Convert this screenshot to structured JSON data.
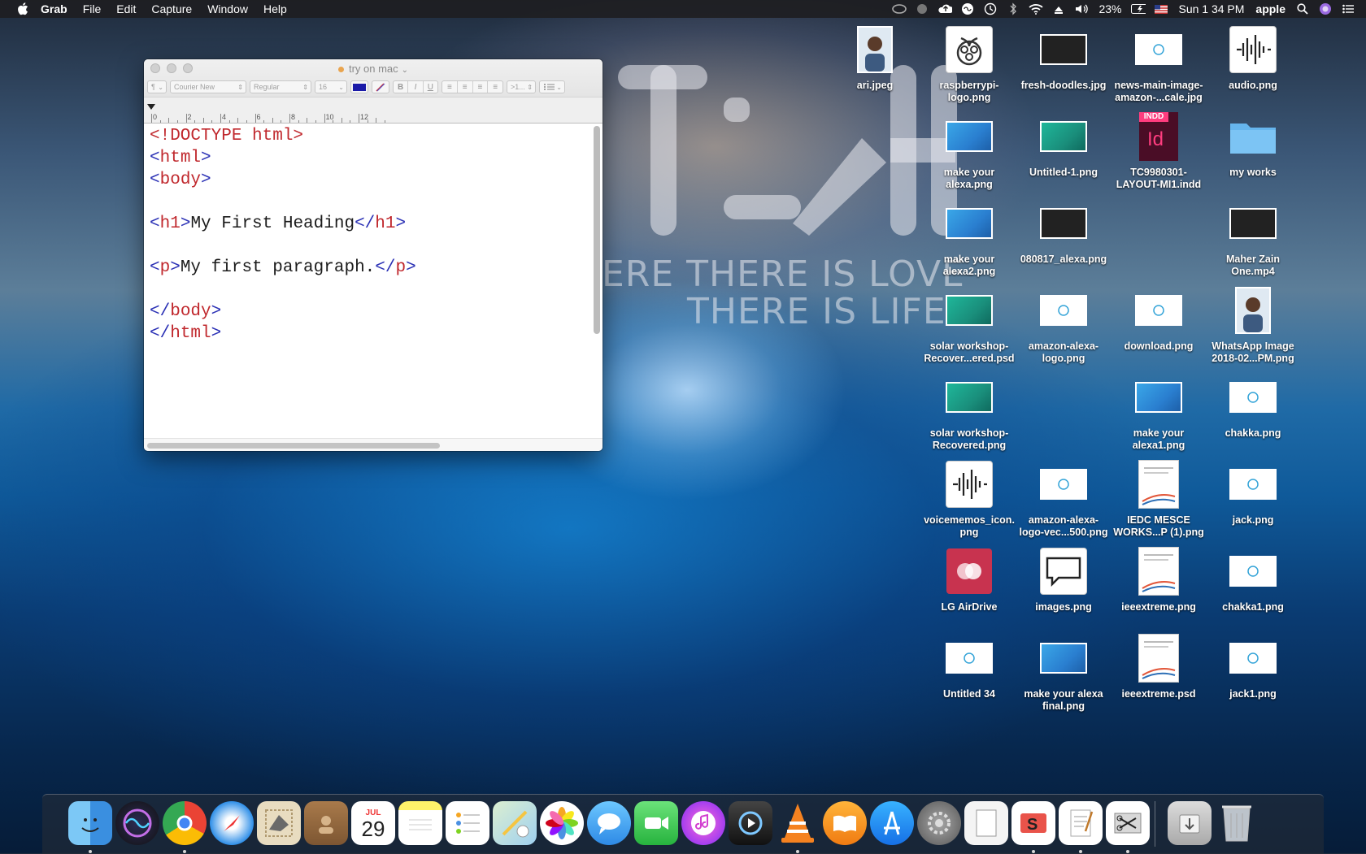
{
  "menubar": {
    "app": "Grab",
    "items": [
      "File",
      "Edit",
      "Capture",
      "Window",
      "Help"
    ],
    "battery": "23%",
    "clock": "Sun 1 34 PM",
    "user": "apple"
  },
  "wallpaper": {
    "line1": "ERE THERE IS LOVE",
    "line2": "THERE IS LIFE"
  },
  "textedit": {
    "title": "try on mac",
    "font_family": "Courier New",
    "font_style": "Regular",
    "font_size": "16",
    "paragraph_btn": "¶",
    "spacing": ">1...",
    "ruler_numbers": [
      "0",
      "2",
      "4",
      "6",
      "8",
      "10",
      "12"
    ],
    "lines": [
      {
        "parts": [
          [
            "tag",
            "<!DOCTYPE html>"
          ]
        ]
      },
      {
        "parts": [
          [
            "br",
            "<"
          ],
          [
            "tag",
            "html"
          ],
          [
            "br",
            ">"
          ]
        ]
      },
      {
        "parts": [
          [
            "br",
            "<"
          ],
          [
            "tag",
            "body"
          ],
          [
            "br",
            ">"
          ]
        ]
      },
      {
        "parts": []
      },
      {
        "parts": [
          [
            "br",
            "<"
          ],
          [
            "tag",
            "h1"
          ],
          [
            "br",
            ">"
          ],
          [
            "txt",
            "My First Heading"
          ],
          [
            "br",
            "</"
          ],
          [
            "tag",
            "h1"
          ],
          [
            "br",
            ">"
          ]
        ]
      },
      {
        "parts": []
      },
      {
        "parts": [
          [
            "br",
            "<"
          ],
          [
            "tag",
            "p"
          ],
          [
            "br",
            ">"
          ],
          [
            "txt",
            "My first paragraph."
          ],
          [
            "br",
            "</"
          ],
          [
            "tag",
            "p"
          ],
          [
            "br",
            ">"
          ]
        ]
      },
      {
        "parts": []
      },
      {
        "parts": [
          [
            "br",
            "</"
          ],
          [
            "tag",
            "body"
          ],
          [
            "br",
            ">"
          ]
        ]
      },
      {
        "parts": [
          [
            "br",
            "</"
          ],
          [
            "tag",
            "html"
          ],
          [
            "br",
            ">"
          ]
        ]
      }
    ]
  },
  "desktop": {
    "icons": [
      {
        "label": "ari.jpeg",
        "kind": "photo"
      },
      {
        "label": "raspberrypi-\nlogo.png",
        "kind": "raspberry"
      },
      {
        "label": "fresh-doodles.jpg",
        "kind": "dark"
      },
      {
        "label": "news-main-image-\namazon-...cale.jpg",
        "kind": "white"
      },
      {
        "label": "audio.png",
        "kind": "audio"
      },
      {
        "label": "make your\nalexa.png",
        "kind": "blue"
      },
      {
        "label": "Untitled-1.png",
        "kind": "teal"
      },
      {
        "label": "TC9980301-\nLAYOUT-MI1.indd",
        "kind": "indd"
      },
      {
        "label": "my works",
        "kind": "folder"
      },
      {
        "label": "make your\nalexa2.png",
        "kind": "blue"
      },
      {
        "label": "080817_alexa.png",
        "kind": "dark"
      },
      {
        "label": "Maher Zain\nOne.mp4",
        "kind": "dark"
      },
      {
        "label": "solar workshop-\nRecover...ered.psd",
        "kind": "teal"
      },
      {
        "label": "amazon-alexa-\nlogo.png",
        "kind": "white"
      },
      {
        "label": "download.png",
        "kind": "white"
      },
      {
        "label": "WhatsApp Image\n2018-02...PM.png",
        "kind": "photo"
      },
      {
        "label": "solar workshop-\nRecovered.png",
        "kind": "teal"
      },
      {
        "label": "make your\nalexa1.png",
        "kind": "blue"
      },
      {
        "label": "chakka.png",
        "kind": "white"
      },
      {
        "label": "voicememos_icon.\npng",
        "kind": "audio"
      },
      {
        "label": "amazon-alexa-\nlogo-vec...500.png",
        "kind": "white"
      },
      {
        "label": "IEDC MESCE\nWORKS...P (1).png",
        "kind": "doc"
      },
      {
        "label": "jack.png",
        "kind": "white"
      },
      {
        "label": "LG AirDrive",
        "kind": "lg"
      },
      {
        "label": "images.png",
        "kind": "bubble"
      },
      {
        "label": "ieeextreme.png",
        "kind": "doc"
      },
      {
        "label": "chakka1.png",
        "kind": "white"
      },
      {
        "label": "Untitled 34",
        "kind": "white"
      },
      {
        "label": "make your alexa\nfinal.png",
        "kind": "blue"
      },
      {
        "label": "ieeextreme.psd",
        "kind": "doc"
      },
      {
        "label": "jack1.png",
        "kind": "white"
      }
    ]
  },
  "dock": {
    "calendar_month": "JUL",
    "calendar_day": "29",
    "apps": [
      "Finder",
      "Siri",
      "Chrome",
      "Safari",
      "Mail",
      "Contacts",
      "Calendar",
      "Notes",
      "Reminders",
      "Maps",
      "Photos",
      "Messages",
      "FaceTime",
      "iTunes",
      "QuickTime",
      "VLC",
      "iBooks",
      "App Store",
      "System Preferences",
      "Preview",
      "Slides",
      "TextEdit",
      "Grab",
      "Downloads",
      "Trash"
    ]
  },
  "colors": {
    "tag": "#c0282d",
    "bracket": "#2b31b5",
    "text": "#1b1b1b"
  }
}
